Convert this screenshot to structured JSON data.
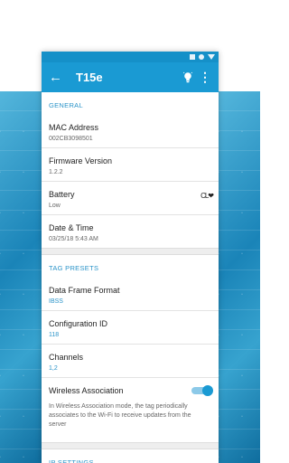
{
  "app_bar": {
    "title": "T15e",
    "back_icon": "arrow-left-icon",
    "light_icon": "lightbulb-icon",
    "more_icon": "more-vert-icon"
  },
  "status_bar_icons": [
    "square-icon",
    "circle-icon",
    "triangle-icon"
  ],
  "general": {
    "header": "GENERAL",
    "items": [
      {
        "label": "MAC Address",
        "value": "002CB3098501"
      },
      {
        "label": "Firmware Version",
        "value": "1.2.2"
      },
      {
        "label": "Battery",
        "value": "Low"
      },
      {
        "label": "Date & Time",
        "value": "03/25/18 5:43 AM"
      }
    ],
    "battery_icon": "CL❤"
  },
  "tag_presets": {
    "header": "TAG PRESETS",
    "items": [
      {
        "label": "Data Frame Format",
        "value": "IBSS"
      },
      {
        "label": "Configuration ID",
        "value": "118"
      },
      {
        "label": "Channels",
        "value": "1,2"
      }
    ]
  },
  "wireless": {
    "label": "Wireless Association",
    "enabled": true,
    "description": "In Wireless Association mode, the tag periodically associates to the Wi-Fi to receive updates from the server"
  },
  "ip_settings": {
    "header": "IP SETTINGS"
  },
  "colors": {
    "primary": "#1a9ad3",
    "status_bar": "#1590c8",
    "accent_text": "#2b94c9"
  }
}
